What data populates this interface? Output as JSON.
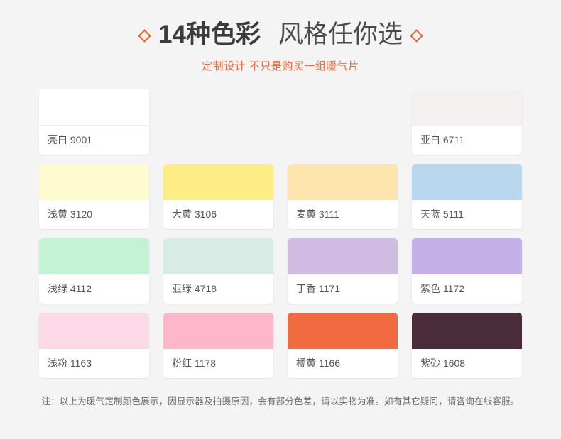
{
  "header": {
    "title_strong": "14种色彩",
    "title_light": "风格任你选",
    "left_marker": "diamond",
    "right_marker": "diamond",
    "subtitle": "定制设计  不只是购买一组暖气片",
    "accent_color": "#ec6327",
    "subtitle_color": "#f1683a"
  },
  "palette": {
    "rows": [
      [
        {
          "name": "亮白 9001",
          "color": "#ffffff",
          "is_white": true
        },
        {
          "name": "",
          "color": "",
          "empty": true
        },
        {
          "name": "",
          "color": "",
          "empty": true
        },
        {
          "name": "亚白 6711",
          "color": "#f5f0f0",
          "is_white": false
        }
      ],
      [
        {
          "name": "浅黄 3120",
          "color": "#fdfbcf"
        },
        {
          "name": "大黄 3106",
          "color": "#fcee85"
        },
        {
          "name": "麦黄 3111",
          "color": "#fde5ad"
        },
        {
          "name": "天蓝 5111",
          "color": "#b9d8f0"
        }
      ],
      [
        {
          "name": "浅绿 4112",
          "color": "#c4f3d3"
        },
        {
          "name": "亚绿 4718",
          "color": "#d8ebe4"
        },
        {
          "name": "丁香 1171",
          "color": "#d0bbe2"
        },
        {
          "name": "紫色 1172",
          "color": "#c4b0e8"
        }
      ],
      [
        {
          "name": "浅粉 1163",
          "color": "#fcd9e6"
        },
        {
          "name": "粉红 1178",
          "color": "#fcb8ca"
        },
        {
          "name": "橘黄 1166",
          "color": "#f26a3f"
        },
        {
          "name": "紫砂 1608",
          "color": "#4a2b3a"
        }
      ]
    ]
  },
  "footer": {
    "note": "注：以上为暖气定制颜色展示，因显示器及拍摄原因，会有部分色差，请以实物为准。如有其它疑问，请咨询在线客服。"
  }
}
